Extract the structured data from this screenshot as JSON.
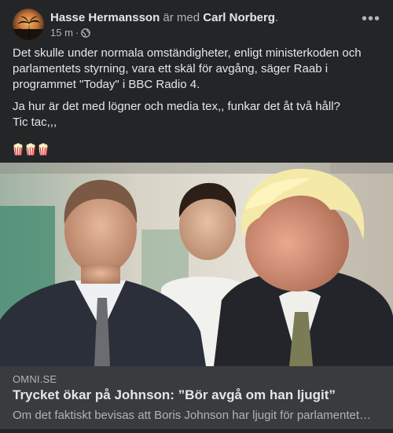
{
  "post": {
    "author": "Hasse Hermansson",
    "with_text": "är med",
    "tagged": "Carl Norberg",
    "tagged_suffix": ".",
    "time": "15 m",
    "separator": "·",
    "privacy_icon": "globe-icon",
    "more_label": "•••",
    "paragraphs": [
      "Det skulle under normala omständigheter, enligt ministerkoden och parlamentets styrning, vara ett skäl för avgång, säger Raab i programmet \"Today\" i BBC Radio 4.",
      "Ja hur är det med lögner och media tex,, funkar det åt två håll?",
      "Tic tac,,,"
    ],
    "emojis": [
      "popcorn-emoji",
      "popcorn-emoji",
      "popcorn-emoji"
    ]
  },
  "link": {
    "domain": "OMNI.SE",
    "headline": "Trycket ökar på Johnson: ”Bör avgå om han ljugit”",
    "description": "Om det faktiskt bevisas att Boris Johnson har ljugit för parlamentet…"
  },
  "colors": {
    "background": "#242526",
    "link_box": "#3a3b3c",
    "primary_text": "#e4e6eb",
    "secondary_text": "#b0b3b8"
  }
}
